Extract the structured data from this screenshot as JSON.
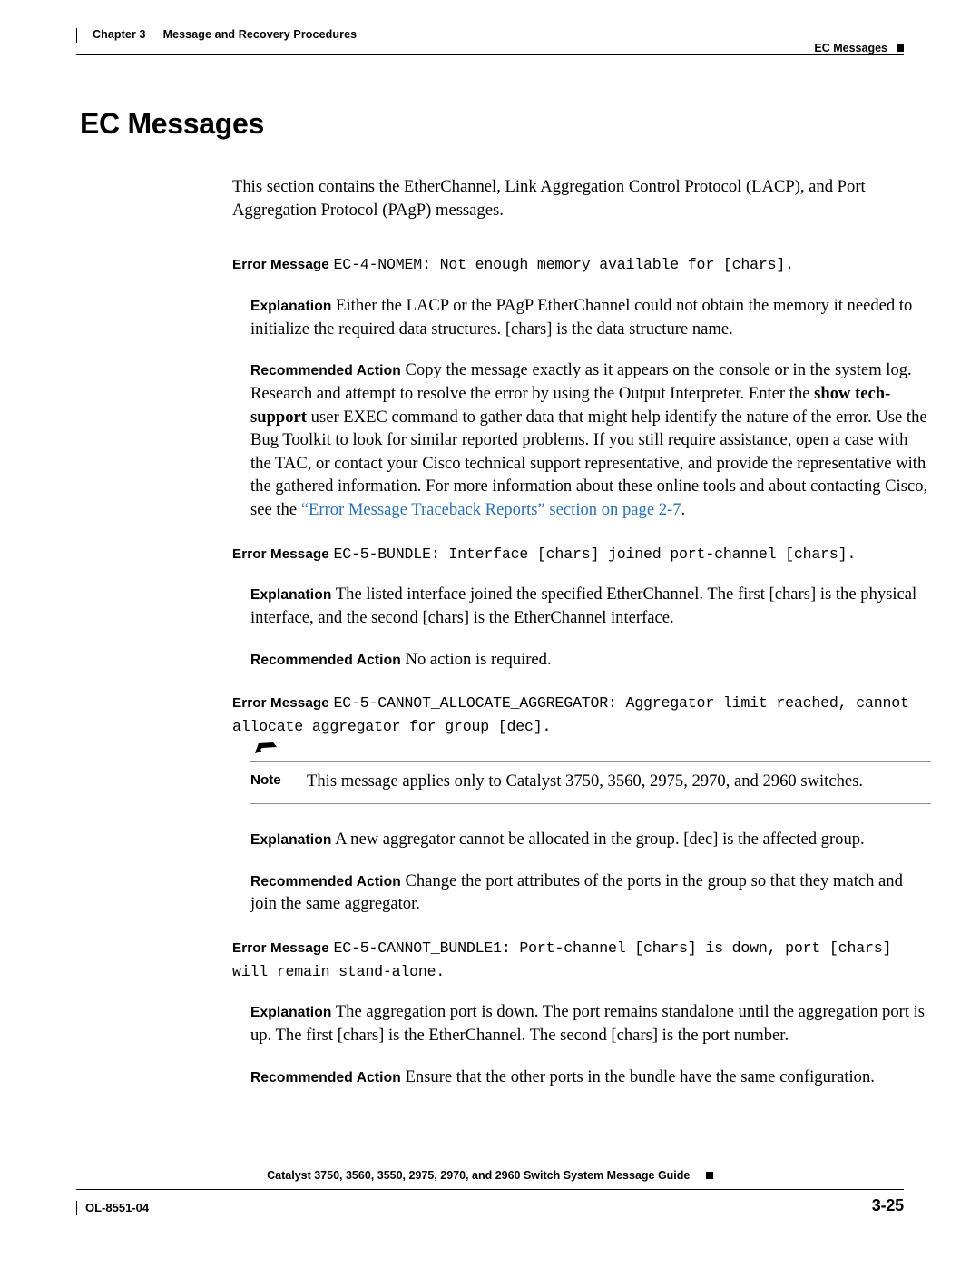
{
  "header": {
    "chapter": "Chapter 3",
    "chapter_title": "Message and Recovery Procedures",
    "running_head": "EC Messages"
  },
  "page": {
    "title": "EC Messages",
    "intro": "This section contains the EtherChannel, Link Aggregation Control Protocol (LACP), and Port Aggregation Protocol (PAgP) messages."
  },
  "labels": {
    "error_message": "Error Message",
    "explanation": "Explanation",
    "recommended_action": "Recommended Action",
    "note": "Note"
  },
  "messages": [
    {
      "id": "ec-4-nomem",
      "error_text": "EC-4-NOMEM: Not enough memory available for [chars].",
      "explanation": "Either the LACP or the PAgP EtherChannel could not obtain the memory it needed to initialize the required data structures. [chars] is the data structure name.",
      "action_part1": "Copy the message exactly as it appears on the console or in the system log. Research and attempt to resolve the error by using the Output Interpreter. Enter the ",
      "action_bold1": "show tech-support",
      "action_part2": " user EXEC command to gather data that might help identify the nature of the error. Use the Bug Toolkit to look for similar reported problems. If you still require assistance, open a case with the TAC, or contact your Cisco technical support representative, and provide the representative with the gathered information. For more information about these online tools and about contacting Cisco, see the ",
      "action_link": "“Error Message Traceback Reports” section on page 2-7",
      "action_part3": "."
    },
    {
      "id": "ec-5-bundle",
      "error_text": "EC-5-BUNDLE: Interface [chars] joined port-channel [chars].",
      "explanation": "The listed interface joined the specified EtherChannel. The first [chars] is the physical interface, and the second [chars] is the EtherChannel interface.",
      "action": "No action is required."
    },
    {
      "id": "ec-5-cannot-allocate-aggregator",
      "error_text": "EC-5-CANNOT_ALLOCATE_AGGREGATOR: Aggregator limit reached, cannot allocate aggregator for group [dec].",
      "note": "This message applies only to Catalyst 3750, 3560, 2975, 2970, and 2960 switches.",
      "explanation": "A new aggregator cannot be allocated in the group. [dec] is the affected group.",
      "action": "Change the port attributes of the ports in the group so that they match and join the same aggregator."
    },
    {
      "id": "ec-5-cannot-bundle1",
      "error_text": "EC-5-CANNOT_BUNDLE1: Port-channel [chars] is down, port [chars] will remain stand-alone.",
      "explanation": "The aggregation port is down. The port remains standalone until the aggregation port is up. The first [chars] is the EtherChannel. The second [chars] is the port number.",
      "action": "Ensure that the other ports in the bundle have the same configuration."
    }
  ],
  "footer": {
    "doc_id": "OL-8551-04",
    "guide_title": "Catalyst 3750, 3560, 3550, 2975, 2970, and 2960 Switch System Message Guide",
    "page_number": "3-25"
  },
  "colors": {
    "link": "#2a72b5",
    "rule": "#000000",
    "note_rule": "#8c8c8c"
  }
}
